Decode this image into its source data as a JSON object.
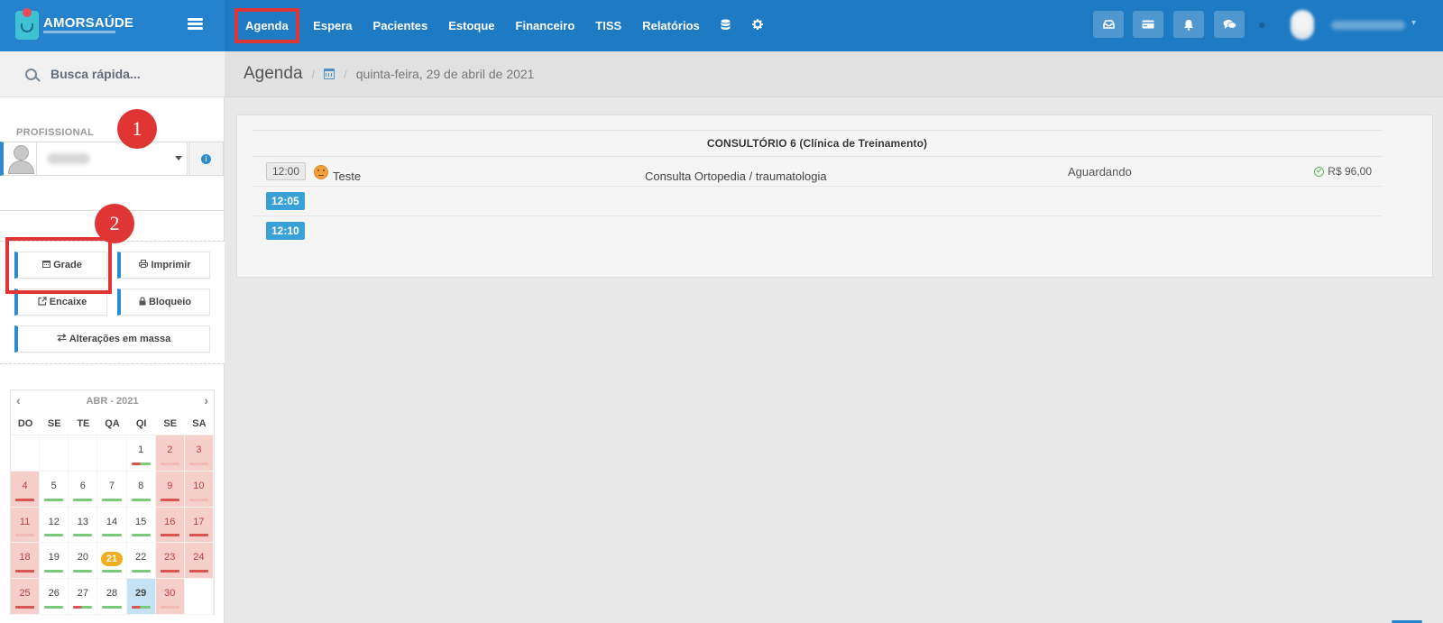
{
  "brand": {
    "name": "AMORSAÚDE"
  },
  "nav": {
    "items": [
      {
        "label": "Agenda",
        "active": true
      },
      {
        "label": "Espera"
      },
      {
        "label": "Pacientes"
      },
      {
        "label": "Estoque"
      },
      {
        "label": "Financeiro"
      },
      {
        "label": "TISS"
      },
      {
        "label": "Relatórios"
      }
    ],
    "icon_items": [
      "database-icon",
      "gear-icon"
    ]
  },
  "topbar_buttons": [
    "inbox-icon",
    "card-icon",
    "bell-icon",
    "chat-icon"
  ],
  "sidebar": {
    "search_placeholder": "Busca rápida...",
    "profissional_label": "PROFISSIONAL",
    "buttons": {
      "grade": "Grade",
      "imprimir": "Imprimir",
      "encaixe": "Encaixe",
      "bloqueio": "Bloqueio",
      "alteracoes": "Alterações em massa"
    }
  },
  "callouts": [
    "1",
    "2"
  ],
  "calendar": {
    "title": "ABR - 2021",
    "weekdays": [
      "DO",
      "SE",
      "TE",
      "QA",
      "QI",
      "SE",
      "SA"
    ],
    "days": {
      "d1": "1",
      "d2": "2",
      "d3": "3",
      "d4": "4",
      "d5": "5",
      "d6": "6",
      "d7": "7",
      "d8": "8",
      "d9": "9",
      "d10": "10",
      "d11": "11",
      "d12": "12",
      "d13": "13",
      "d14": "14",
      "d15": "15",
      "d16": "16",
      "d17": "17",
      "d18": "18",
      "d19": "19",
      "d20": "20",
      "d21": "21",
      "d22": "22",
      "d23": "23",
      "d24": "24",
      "d25": "25",
      "d26": "26",
      "d27": "27",
      "d28": "28",
      "d29": "29",
      "d30": "30"
    },
    "highlighted_day": "21",
    "selected_day": "29"
  },
  "breadcrumb": {
    "title": "Agenda",
    "date": "quinta-feira, 29 de abril de 2021"
  },
  "schedule": {
    "room": "CONSULTÓRIO 6 (Clínica de Treinamento)",
    "rows": [
      {
        "time": "12:00",
        "patient": "Teste",
        "procedure": "Consulta Ortopedia / traumatologia",
        "status": "Aguardando",
        "price": "R$ 96,00"
      },
      {
        "time": "12:05"
      },
      {
        "time": "12:10"
      }
    ]
  },
  "colors": {
    "topbar": "#1e7ac2",
    "accent": "#2d8bd0",
    "callout": "#e03535",
    "weekend": "#f7cfca",
    "today": "#f0ad1e",
    "free_slot": "#3aa0d8"
  }
}
